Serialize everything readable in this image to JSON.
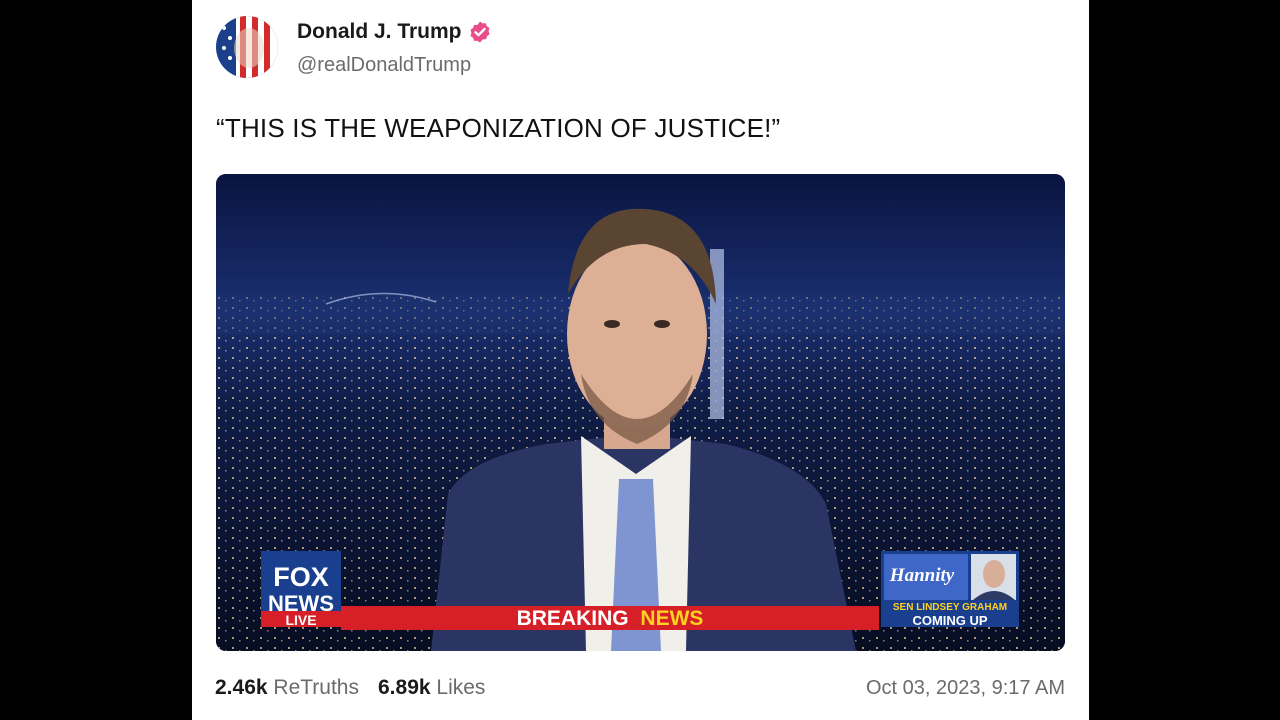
{
  "post": {
    "author_name": "Donald J. Trump",
    "author_handle": "@realDonaldTrump",
    "verified_icon": "verified-badge-icon",
    "text": "“THIS IS THE WEAPONIZATION OF JUSTICE!”",
    "retruths_count": "2.46k",
    "retruths_label": "ReTruths",
    "likes_count": "6.89k",
    "likes_label": "Likes",
    "timestamp": "Oct 03, 2023, 9:17 AM"
  },
  "media": {
    "network_logo_line1": "FOX",
    "network_logo_line2": "NEWS",
    "network_logo_line3": "LIVE",
    "banner_word1": "BREAKING",
    "banner_word2": "NEWS",
    "show_name": "Hannity",
    "guest_line": "SEN LINDSEY GRAHAM",
    "guest_status": "COMING UP"
  },
  "colors": {
    "accent_badge": "#ea4c89",
    "banner_red": "#d61f26",
    "banner_yellow": "#ffd21f",
    "fox_blue": "#1b3f8f"
  }
}
